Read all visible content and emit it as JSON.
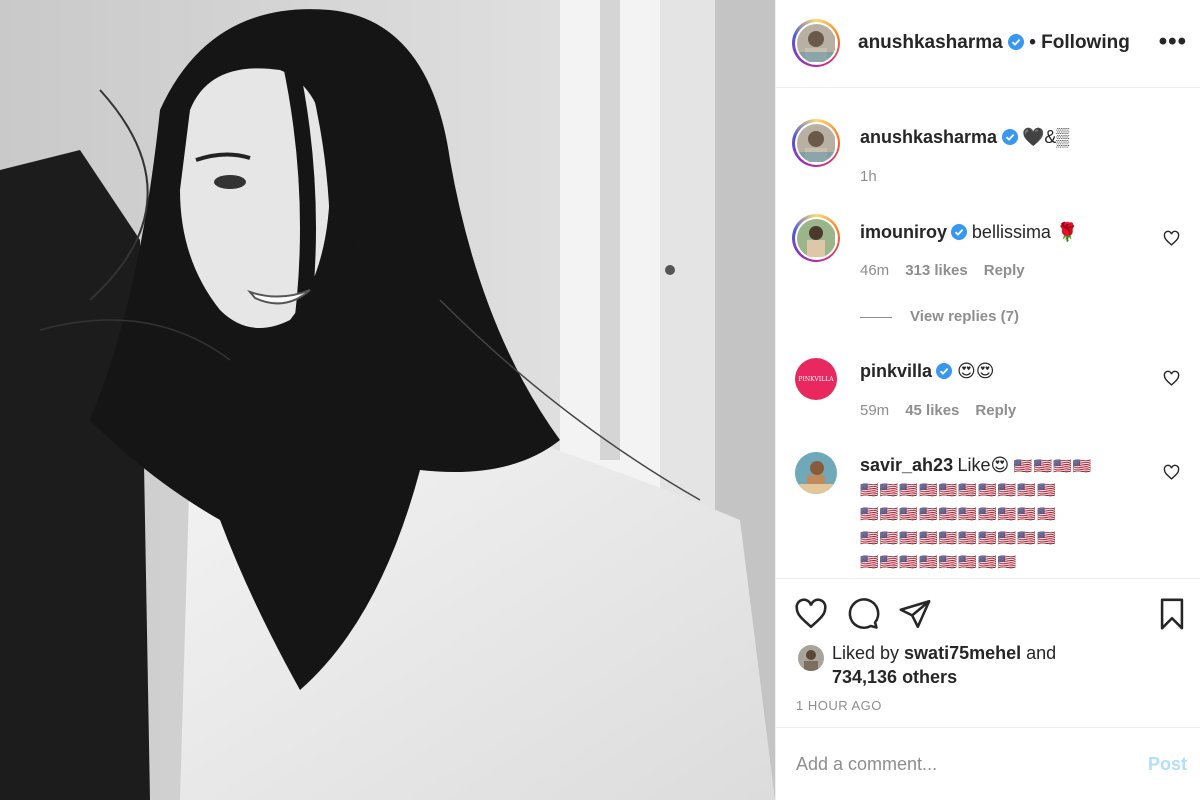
{
  "post": {
    "username": "anushkasharma",
    "follow_status": "• Following",
    "more_icon": "more-options-icon"
  },
  "caption": {
    "username": "anushkasharma",
    "text": "🖤&▒",
    "time": "1h"
  },
  "comments": [
    {
      "username": "imouniroy",
      "verified": true,
      "text": "bellissima 🌹",
      "time": "46m",
      "likes": "313 likes",
      "reply": "Reply"
    },
    {
      "username": "pinkvilla",
      "verified": true,
      "text": "😍😍",
      "time": "59m",
      "likes": "45 likes",
      "reply": "Reply",
      "avatar_text": "PINKVILLA"
    },
    {
      "username": "savir_ah23",
      "verified": false,
      "text": "Like😍",
      "flags": [
        "🇺🇸🇺🇸🇺🇸🇺🇸",
        "🇺🇸🇺🇸🇺🇸🇺🇸🇺🇸🇺🇸🇺🇸🇺🇸🇺🇸🇺🇸",
        "🇺🇸🇺🇸🇺🇸🇺🇸🇺🇸🇺🇸🇺🇸🇺🇸🇺🇸🇺🇸",
        "🇺🇸🇺🇸🇺🇸🇺🇸🇺🇸🇺🇸🇺🇸🇺🇸🇺🇸🇺🇸",
        "🇺🇸🇺🇸🇺🇸🇺🇸🇺🇸🇺🇸🇺🇸🇺🇸"
      ]
    }
  ],
  "view_replies": "View replies (7)",
  "likes": {
    "prefix": "Liked by ",
    "user": "swati75mehel",
    "middle": " and",
    "others": "734,136 others"
  },
  "timestamp": "1 HOUR AGO",
  "comment_input": {
    "placeholder": "Add a comment...",
    "post_label": "Post"
  },
  "colors": {
    "verified": "#3897f0",
    "pinkvilla": "#e8285e",
    "post_disabled": "#b2dffc",
    "meta": "#8e8e8e"
  }
}
